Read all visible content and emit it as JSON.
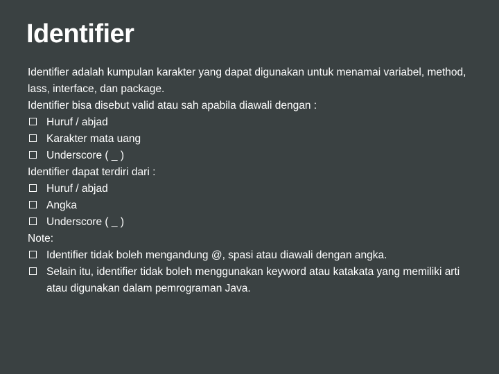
{
  "title": "Identifier",
  "p1": "Identifier adalah kumpulan karakter yang dapat digunakan untuk menamai variabel, method, lass, interface, dan package.",
  "p2": "Identifier bisa disebut valid atau sah apabila diawali dengan :",
  "b1": "Huruf / abjad",
  "b2": "Karakter mata uang",
  "b3": "Underscore ( _ )",
  "p3": "Identifier dapat terdiri dari :",
  "b4": "Huruf / abjad",
  "b5": "Angka",
  "b6": "Underscore ( _ )",
  "p4": "Note:",
  "b7": "Identifier tidak boleh mengandung @, spasi atau diawali dengan angka.",
  "b8": "Selain itu, identifier tidak boleh menggunakan keyword atau katakata yang memiliki arti atau digunakan dalam pemrograman Java."
}
